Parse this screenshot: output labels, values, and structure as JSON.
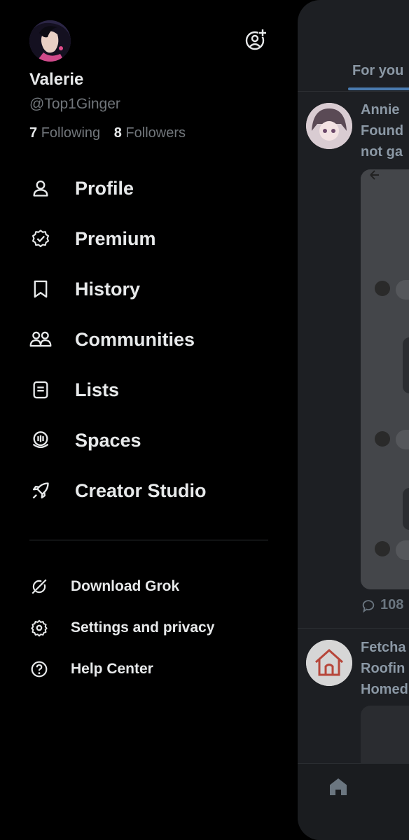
{
  "profile": {
    "name": "Valerie",
    "handle": "@Top1Ginger",
    "following_count": "7",
    "following_label": "Following",
    "followers_count": "8",
    "followers_label": "Followers"
  },
  "menu": [
    {
      "label": "Profile",
      "icon": "person-icon"
    },
    {
      "label": "Premium",
      "icon": "verified-badge-icon"
    },
    {
      "label": "History",
      "icon": "bookmark-icon"
    },
    {
      "label": "Communities",
      "icon": "communities-icon"
    },
    {
      "label": "Lists",
      "icon": "list-icon"
    },
    {
      "label": "Spaces",
      "icon": "spaces-icon"
    },
    {
      "label": "Creator Studio",
      "icon": "rocket-icon"
    }
  ],
  "secondary_menu": [
    {
      "label": "Download Grok",
      "icon": "grok-icon"
    },
    {
      "label": "Settings and privacy",
      "icon": "gear-icon"
    },
    {
      "label": "Help Center",
      "icon": "help-icon"
    }
  ],
  "feed": {
    "tab_label": "For you",
    "post1": {
      "line1": "Annie",
      "line2": "Found",
      "line3": "not ga"
    },
    "post1_reply_count": "108",
    "post2": {
      "line1": "Fetcha",
      "line2": "Roofin",
      "line3": "Homed"
    }
  },
  "colors": {
    "background": "#000000",
    "text": "#e7e9ea",
    "muted": "#71767b"
  }
}
